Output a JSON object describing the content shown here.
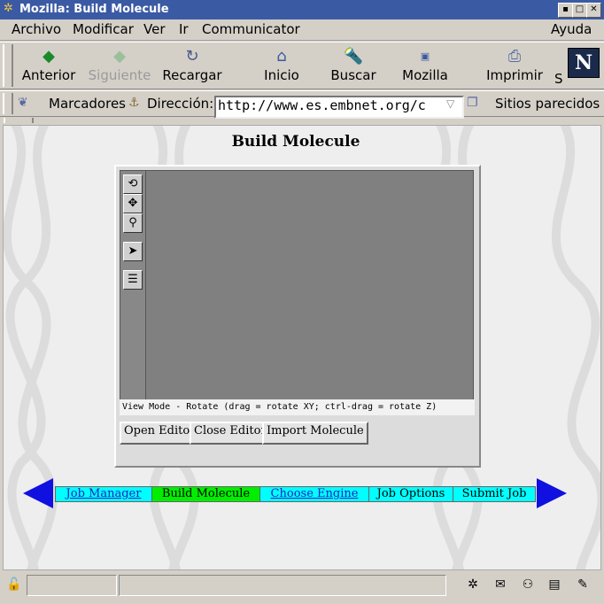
{
  "window": {
    "title": "Mozilla: Build Molecule"
  },
  "menu": {
    "items": [
      "Archivo",
      "Modificar",
      "Ver",
      "Ir",
      "Communicator"
    ],
    "help": "Ayuda"
  },
  "nav": {
    "back": "Anterior",
    "forward": "Siguiente",
    "reload": "Recargar",
    "home": "Inicio",
    "search": "Buscar",
    "mozilla": "Mozilla",
    "print": "Imprimir",
    "security_partial": "S",
    "logo_letter": "N"
  },
  "location": {
    "bookmarks": "Marcadores",
    "address_label": "Dirección:",
    "url": "http://www.es.embnet.org/c",
    "related": "Sitios parecidos"
  },
  "page": {
    "title": "Build Molecule",
    "applet": {
      "status": "View Mode - Rotate (drag = rotate XY; ctrl-drag = rotate Z)",
      "buttons": {
        "open": "Open Editor",
        "close": "Close Editor",
        "import": "Import Molecule"
      }
    },
    "steps": [
      {
        "label": "Job Manager",
        "link": true,
        "color": "#00ffff"
      },
      {
        "label": "Build Molecule",
        "link": false,
        "color": "#00ee00"
      },
      {
        "label": "Choose Engine",
        "link": true,
        "color": "#00ffff"
      },
      {
        "label": "Job Options",
        "link": false,
        "color": "#00ffff"
      },
      {
        "label": "Submit Job",
        "link": false,
        "color": "#00ffff"
      }
    ]
  },
  "colors": {
    "titlebar": "#3b5aa4",
    "nav_arrow": "#1010e0",
    "active_step": "#00ee00",
    "step": "#00ffff"
  }
}
